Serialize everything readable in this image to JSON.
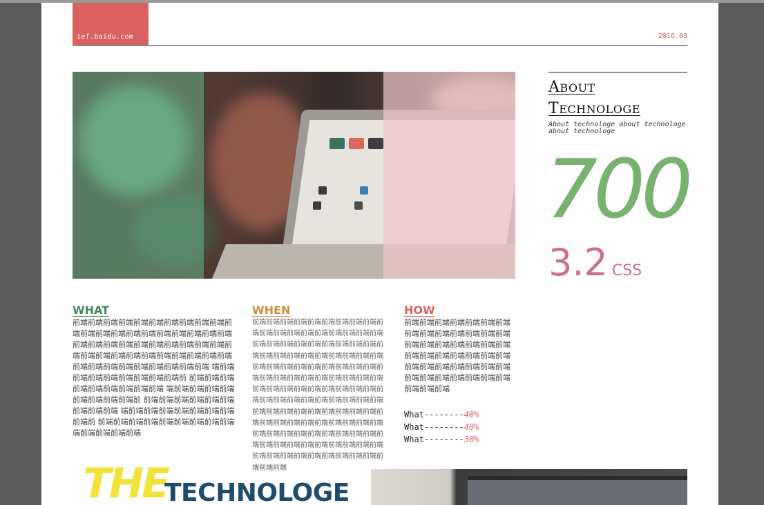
{
  "header": {
    "brand": "ief.baidu.com",
    "date": "2016.03"
  },
  "about": {
    "title_line1_cap": "A",
    "title_line1_rest": "BOUT",
    "title_line2_cap": "T",
    "title_line2_rest": "ECHNOLOGE",
    "subtitle": "About technologe about technologe about technologe",
    "big_number": "700",
    "version_number": "3.2",
    "version_unit": "CSS"
  },
  "columns": [
    {
      "heading": "WHAT",
      "text": "前端前端前端前端前端前端前端前端前端前端前端前端前端前端前端前端前端前端前端前端前端前端前端前端前端前端前端前端前端前端前端前端前端前端前端前端前端前端前端前端前端前端 前端前端前端前端前端前端前端前端前端 端前端前端前端前端前端前端前端前端前 前端前端前端前端前端前端前端前端前端 端前端前端前端前端前端前端前端前端前 前端前端前端前端前端前端前端前端前端 端前端前端前端前端前端前端前端前端前 前端前端前端前端前端前端前端前端前端 端前端前端前端前端"
    },
    {
      "heading": "WHEN",
      "text": "前端前端前端前端前端前端前端前端前端前端前端前端前端前端前端前端前端前端前端前端前端前端前端前端前端前端前端前端前端前端前端前端前端前端前端前端前端前端前端前端前端前端前端前端前端前端前端前端前端前端前端前端前端前端前端前端前端前端前端前端前端前端前端前端前端前端前端前端前端前端前端前端前端前端前端前端前端前端前端前端前端前端前端前端前端前端前端前端前端前端前端前端前端前端前端前端前端前端前端前端前端前端前端前端前端前端前端前端前端前端前端前端前端前端前端前端前端前端前端前端前端前端前端前端前端前端"
    },
    {
      "heading": "HOW",
      "text": "前端前端前端前端前端前端前端前端前端前端前端前端前端前端前端前端前端前端前端前端前端前端前端前端前端前端前端前端前端前端前端前端前端前端前端前端前端前端前端前端前端前端前端前端前端"
    }
  ],
  "stats": [
    {
      "label": "What--------",
      "value": "40%"
    },
    {
      "label": "What--------",
      "value": "40%"
    },
    {
      "label": "What--------",
      "value": "30%"
    }
  ],
  "bottom": {
    "the": "THE",
    "technologe": "TECHNOLOGE"
  },
  "colors": {
    "brand": "#d9615f",
    "green": "#77b36f",
    "pink": "#cc7186",
    "what": "#3d8a58",
    "when": "#c9913f",
    "how": "#d9615f",
    "the": "#f0e23a",
    "technologe": "#1e4b6e"
  }
}
